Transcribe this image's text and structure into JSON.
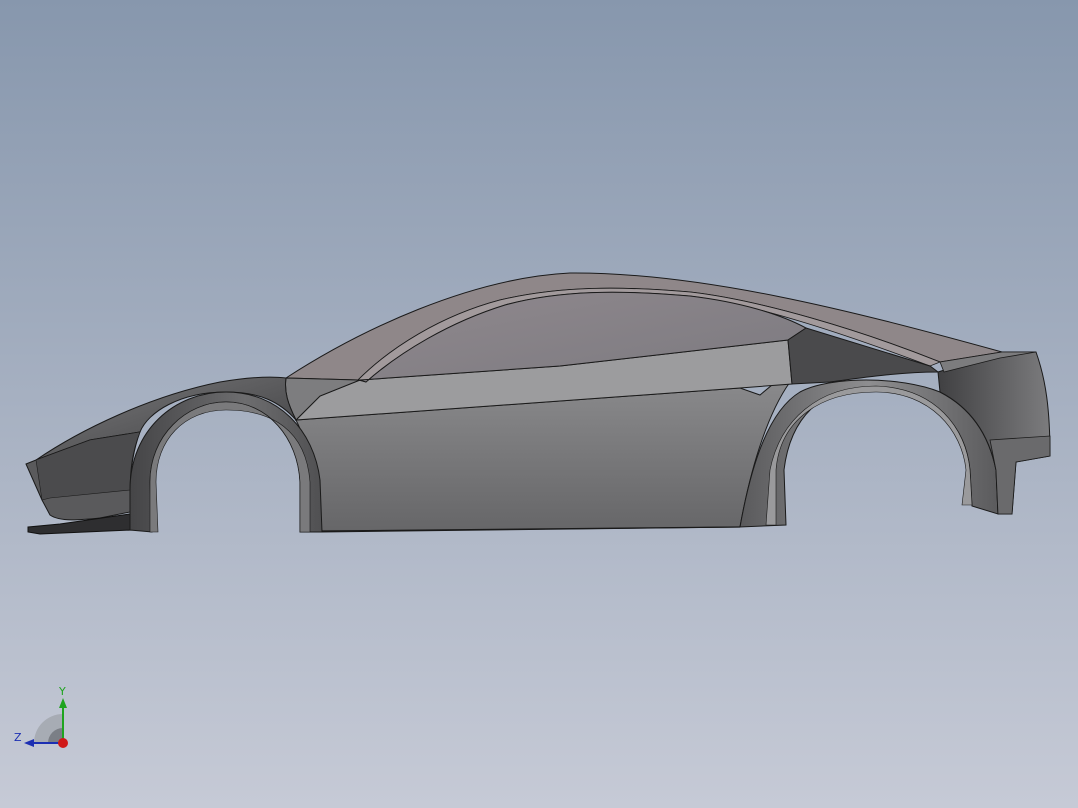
{
  "viewport": {
    "background_top_color": "#8797ad",
    "background_bottom_color": "#c6cad6"
  },
  "model": {
    "body_color": "#6e6e70",
    "body_light_color": "#a2a2a4",
    "body_dark_color": "#3c3c3e",
    "roof_color": "#8e8488",
    "edge_color": "#1a1a1a"
  },
  "triad": {
    "y_label": "Y",
    "z_label": "Z",
    "y_axis_color": "#1fa41f",
    "z_axis_color": "#1c2fb3",
    "x_axis_color": "#d01818"
  }
}
